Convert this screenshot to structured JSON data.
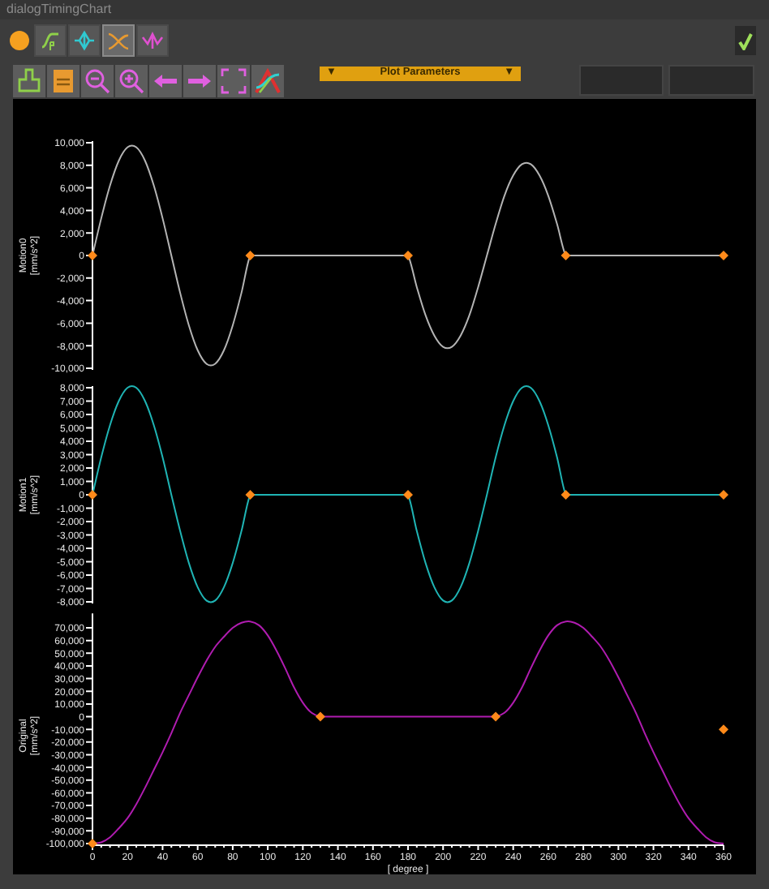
{
  "window": {
    "title": "dialogTimingChart"
  },
  "tabs": [
    {
      "selected": false
    },
    {
      "selected": false
    },
    {
      "selected": true
    },
    {
      "selected": false
    }
  ],
  "plot_parameters": {
    "label": "Plot Parameters",
    "left_arrow": "▼",
    "right_arrow": "▼"
  },
  "charts": [
    {
      "chart_data": {
        "type": "line",
        "ylabel": "Motion0\n[mm/s^2]",
        "xlim": [
          0,
          360
        ],
        "ylim": [
          -10000,
          10000
        ],
        "yticks": [
          {
            "value": -10000,
            "label": "-10,000"
          },
          {
            "value": -8000,
            "label": "-8,000"
          },
          {
            "value": -6000,
            "label": "-6,000"
          },
          {
            "value": -4000,
            "label": "-4,000"
          },
          {
            "value": -2000,
            "label": "-2,000"
          },
          {
            "value": 0,
            "label": "0"
          },
          {
            "value": 2000,
            "label": "2,000"
          },
          {
            "value": 4000,
            "label": "4,000"
          },
          {
            "value": 6000,
            "label": "6,000"
          },
          {
            "value": 8000,
            "label": "8,000"
          },
          {
            "value": 10000,
            "label": "10,000"
          }
        ],
        "x": [
          0,
          5,
          10,
          15,
          20,
          25,
          30,
          35,
          40,
          45,
          50,
          55,
          60,
          65,
          70,
          75,
          80,
          85,
          90,
          95,
          100,
          105,
          110,
          115,
          120,
          125,
          130,
          135,
          140,
          145,
          150,
          155,
          160,
          165,
          170,
          175,
          180,
          185,
          190,
          195,
          200,
          205,
          210,
          215,
          220,
          225,
          230,
          235,
          240,
          245,
          250,
          255,
          260,
          265,
          270,
          275,
          280,
          285,
          290,
          295,
          300,
          305,
          310,
          315,
          320,
          325,
          330,
          335,
          340,
          345,
          350,
          355,
          360
        ],
        "series": [
          {
            "type": "line",
            "color": "#b4b4b4",
            "values": [
              0,
              3300,
              6200,
              8400,
              9600,
              9600,
              8400,
              6200,
              3300,
              0,
              -3300,
              -6200,
              -8400,
              -9600,
              -9600,
              -8400,
              -6200,
              -3300,
              0,
              0,
              0,
              0,
              0,
              0,
              0,
              0,
              0,
              0,
              0,
              0,
              0,
              0,
              0,
              0,
              0,
              0,
              0,
              -2800,
              -5300,
              -7100,
              -8100,
              -8100,
              -7100,
              -5300,
              -2800,
              0,
              2800,
              5300,
              7100,
              8100,
              8100,
              7100,
              5300,
              2800,
              0,
              0,
              0,
              0,
              0,
              0,
              0,
              0,
              0,
              0,
              0,
              0,
              0,
              0,
              0,
              0,
              0,
              0,
              0
            ]
          },
          {
            "type": "scatter",
            "color": "#ff8a1a",
            "values": [
              0,
              null,
              null,
              null,
              null,
              null,
              null,
              null,
              null,
              null,
              null,
              null,
              null,
              null,
              null,
              null,
              null,
              null,
              0,
              null,
              null,
              null,
              null,
              null,
              null,
              null,
              null,
              null,
              null,
              null,
              null,
              null,
              null,
              null,
              null,
              null,
              0,
              null,
              null,
              null,
              null,
              null,
              null,
              null,
              null,
              null,
              null,
              null,
              null,
              null,
              null,
              null,
              null,
              null,
              0,
              null,
              null,
              null,
              null,
              null,
              null,
              null,
              null,
              null,
              null,
              null,
              null,
              null,
              null,
              null,
              null,
              null,
              0
            ]
          }
        ]
      }
    },
    {
      "chart_data": {
        "type": "line",
        "ylabel": "Motion1\n[mm/s^2]",
        "xlim": [
          0,
          360
        ],
        "ylim": [
          -8000,
          8000
        ],
        "yticks": [
          {
            "value": -8000,
            "label": "-8,000"
          },
          {
            "value": -7000,
            "label": "-7,000"
          },
          {
            "value": -6000,
            "label": "-6,000"
          },
          {
            "value": -5000,
            "label": "-5,000"
          },
          {
            "value": -4000,
            "label": "-4,000"
          },
          {
            "value": -3000,
            "label": "-3,000"
          },
          {
            "value": -2000,
            "label": "-2,000"
          },
          {
            "value": -1000,
            "label": "-1,000"
          },
          {
            "value": 0,
            "label": "0"
          },
          {
            "value": 1000,
            "label": "1,000"
          },
          {
            "value": 2000,
            "label": "2,000"
          },
          {
            "value": 3000,
            "label": "3,000"
          },
          {
            "value": 4000,
            "label": "4,000"
          },
          {
            "value": 5000,
            "label": "5,000"
          },
          {
            "value": 6000,
            "label": "6,000"
          },
          {
            "value": 7000,
            "label": "7,000"
          },
          {
            "value": 8000,
            "label": "8,000"
          }
        ],
        "x": [
          0,
          5,
          10,
          15,
          20,
          25,
          30,
          35,
          40,
          45,
          50,
          55,
          60,
          65,
          70,
          75,
          80,
          85,
          90,
          95,
          100,
          105,
          110,
          115,
          120,
          125,
          130,
          135,
          140,
          145,
          150,
          155,
          160,
          165,
          170,
          175,
          180,
          185,
          190,
          195,
          200,
          205,
          210,
          215,
          220,
          225,
          230,
          235,
          240,
          245,
          250,
          255,
          260,
          265,
          270,
          275,
          280,
          285,
          290,
          295,
          300,
          305,
          310,
          315,
          320,
          325,
          330,
          335,
          340,
          345,
          350,
          355,
          360
        ],
        "series": [
          {
            "type": "line",
            "color": "#1fb4b4",
            "values": [
              0,
              2800,
              5200,
              7000,
              8000,
              8000,
              7000,
              5200,
              2800,
              0,
              -2700,
              -5100,
              -6900,
              -7900,
              -7900,
              -6900,
              -5100,
              -2700,
              0,
              0,
              0,
              0,
              0,
              0,
              0,
              0,
              0,
              0,
              0,
              0,
              0,
              0,
              0,
              0,
              0,
              0,
              0,
              -2700,
              -5100,
              -6900,
              -7900,
              -7900,
              -6900,
              -5100,
              -2700,
              0,
              2800,
              5200,
              7000,
              8000,
              8000,
              7000,
              5200,
              2800,
              0,
              0,
              0,
              0,
              0,
              0,
              0,
              0,
              0,
              0,
              0,
              0,
              0,
              0,
              0,
              0,
              0,
              0,
              0
            ]
          },
          {
            "type": "scatter",
            "color": "#ff8a1a",
            "values": [
              0,
              null,
              null,
              null,
              null,
              null,
              null,
              null,
              null,
              null,
              null,
              null,
              null,
              null,
              null,
              null,
              null,
              null,
              0,
              null,
              null,
              null,
              null,
              null,
              null,
              null,
              null,
              null,
              null,
              null,
              null,
              null,
              null,
              null,
              null,
              null,
              0,
              null,
              null,
              null,
              null,
              null,
              null,
              null,
              null,
              null,
              null,
              null,
              null,
              null,
              null,
              null,
              null,
              null,
              0,
              null,
              null,
              null,
              null,
              null,
              null,
              null,
              null,
              null,
              null,
              null,
              null,
              null,
              null,
              null,
              null,
              null,
              0
            ]
          }
        ]
      }
    },
    {
      "chart_data": {
        "type": "line",
        "ylabel": "Original\n[mm/s^2]",
        "xlabel": "[ degree ]",
        "xlim": [
          0,
          360
        ],
        "ylim": [
          -100000,
          80000
        ],
        "xticks": [
          0,
          20,
          40,
          60,
          80,
          100,
          120,
          140,
          160,
          180,
          200,
          220,
          240,
          260,
          280,
          300,
          320,
          340,
          360
        ],
        "yticks": [
          {
            "value": -100000,
            "label": "-100,000"
          },
          {
            "value": -90000,
            "label": "-90,000"
          },
          {
            "value": -80000,
            "label": "-80,000"
          },
          {
            "value": -70000,
            "label": "-70,000"
          },
          {
            "value": -60000,
            "label": "-60,000"
          },
          {
            "value": -50000,
            "label": "-50,000"
          },
          {
            "value": -40000,
            "label": "-40,000"
          },
          {
            "value": -30000,
            "label": "-30,000"
          },
          {
            "value": -20000,
            "label": "-20,000"
          },
          {
            "value": -10000,
            "label": "-10,000"
          },
          {
            "value": 0,
            "label": "0"
          },
          {
            "value": 10000,
            "label": "10,000"
          },
          {
            "value": 20000,
            "label": "20,000"
          },
          {
            "value": 30000,
            "label": "30,000"
          },
          {
            "value": 40000,
            "label": "40,000"
          },
          {
            "value": 50000,
            "label": "50,000"
          },
          {
            "value": 60000,
            "label": "60,000"
          },
          {
            "value": 70000,
            "label": "70,000"
          }
        ],
        "x": [
          0,
          5,
          10,
          15,
          20,
          25,
          30,
          35,
          40,
          45,
          50,
          55,
          60,
          65,
          70,
          75,
          80,
          85,
          90,
          95,
          100,
          105,
          110,
          115,
          120,
          125,
          130,
          135,
          140,
          145,
          150,
          155,
          160,
          165,
          170,
          175,
          180,
          185,
          190,
          195,
          200,
          205,
          210,
          215,
          220,
          225,
          230,
          235,
          240,
          245,
          250,
          255,
          260,
          265,
          270,
          275,
          280,
          285,
          290,
          295,
          300,
          305,
          310,
          315,
          320,
          325,
          330,
          335,
          340,
          345,
          350,
          355,
          360
        ],
        "series": [
          {
            "type": "line",
            "color": "#b01cb0",
            "values": [
              -100000,
              -99000,
              -95000,
              -88000,
              -80000,
              -69000,
              -56000,
              -42000,
              -28000,
              -13000,
              3000,
              17000,
              31000,
              44000,
              55000,
              63000,
              70000,
              74000,
              75000,
              72000,
              64000,
              52000,
              38000,
              23000,
              11000,
              3000,
              0,
              0,
              0,
              0,
              0,
              0,
              0,
              0,
              0,
              0,
              0,
              0,
              0,
              0,
              0,
              0,
              0,
              0,
              0,
              0,
              0,
              3000,
              11000,
              23000,
              38000,
              52000,
              64000,
              72000,
              75000,
              74000,
              70000,
              63000,
              55000,
              44000,
              31000,
              17000,
              3000,
              -13000,
              -28000,
              -42000,
              -56000,
              -69000,
              -80000,
              -88000,
              -95000,
              -99000,
              -100000
            ]
          },
          {
            "type": "scatter",
            "color": "#ff8a1a",
            "values": [
              -100000,
              null,
              null,
              null,
              null,
              null,
              null,
              null,
              null,
              null,
              null,
              null,
              null,
              null,
              null,
              null,
              null,
              null,
              null,
              null,
              null,
              null,
              null,
              null,
              null,
              null,
              0,
              null,
              null,
              null,
              null,
              null,
              null,
              null,
              null,
              null,
              null,
              null,
              null,
              null,
              null,
              null,
              null,
              null,
              null,
              null,
              0,
              null,
              null,
              null,
              null,
              null,
              null,
              null,
              null,
              null,
              null,
              null,
              null,
              null,
              null,
              null,
              null,
              null,
              null,
              null,
              null,
              null,
              null,
              null,
              null,
              null,
              -10000
            ]
          }
        ]
      }
    }
  ]
}
